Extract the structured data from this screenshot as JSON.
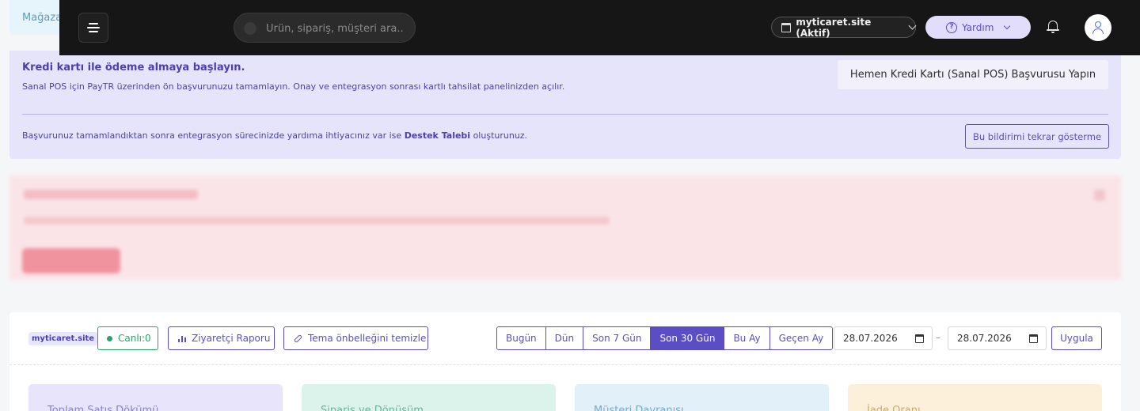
{
  "store_strip": {
    "label": "Mağaza"
  },
  "topbar": {
    "search_placeholder": "Ürün, sipariş, müşteri ara..",
    "site_selector": "myticaret.site (Aktif)",
    "help_label": "Yardım",
    "icons": [
      "menu-icon",
      "search-icon",
      "store-icon",
      "chevron-down-icon",
      "help-icon",
      "bell-icon",
      "user-icon"
    ]
  },
  "pos_banner": {
    "title": "Kredi kartı ile ödeme almaya başlayın.",
    "description": "Sanal POS için PayTR üzerinden ön başvurunuzu tamamlayın. Onay ve entegrasyon sonrası kartlı tahsilat panelinizden açılır.",
    "cta_label": "Hemen Kredi Kartı (Sanal POS) Başvurusu Yapın",
    "note_prefix": "Başvurunuz tamamlandıktan sonra entegrasyon sürecinizde yardıma ihtiyacınız var ise ",
    "note_link": "Destek Talebi",
    "note_suffix": " oluşturunuz.",
    "dismiss_label": "Bu bildirimi tekrar gösterme"
  },
  "filters": {
    "site_tag": "myticaret.site",
    "live_label": "Canlı:0",
    "visitor_report_label": "Ziyaretçi Raporu",
    "clear_cache_label": "Tema önbelleğini temizle",
    "ranges": [
      {
        "label": "Bugün",
        "active": false
      },
      {
        "label": "Dün",
        "active": false
      },
      {
        "label": "Son 7 Gün",
        "active": false
      },
      {
        "label": "Son 30 Gün",
        "active": true
      },
      {
        "label": "Bu Ay",
        "active": false
      },
      {
        "label": "Geçen Ay",
        "active": false
      }
    ],
    "date_start": "28.07.2026",
    "date_separator": "–",
    "date_end": "28.07.2026",
    "apply_label": "Uygula"
  },
  "cards": [
    {
      "title": "Toplam Satış Dökümü"
    },
    {
      "title": "Sipariş ve Dönüşüm"
    },
    {
      "title": "Müşteri Davranışı"
    },
    {
      "title": "İade Oranı"
    }
  ],
  "colors": {
    "accent": "#5b4ec4",
    "live_green": "#27a468",
    "topbar_bg": "#161616",
    "banner_bg": "#e6e4fb"
  }
}
